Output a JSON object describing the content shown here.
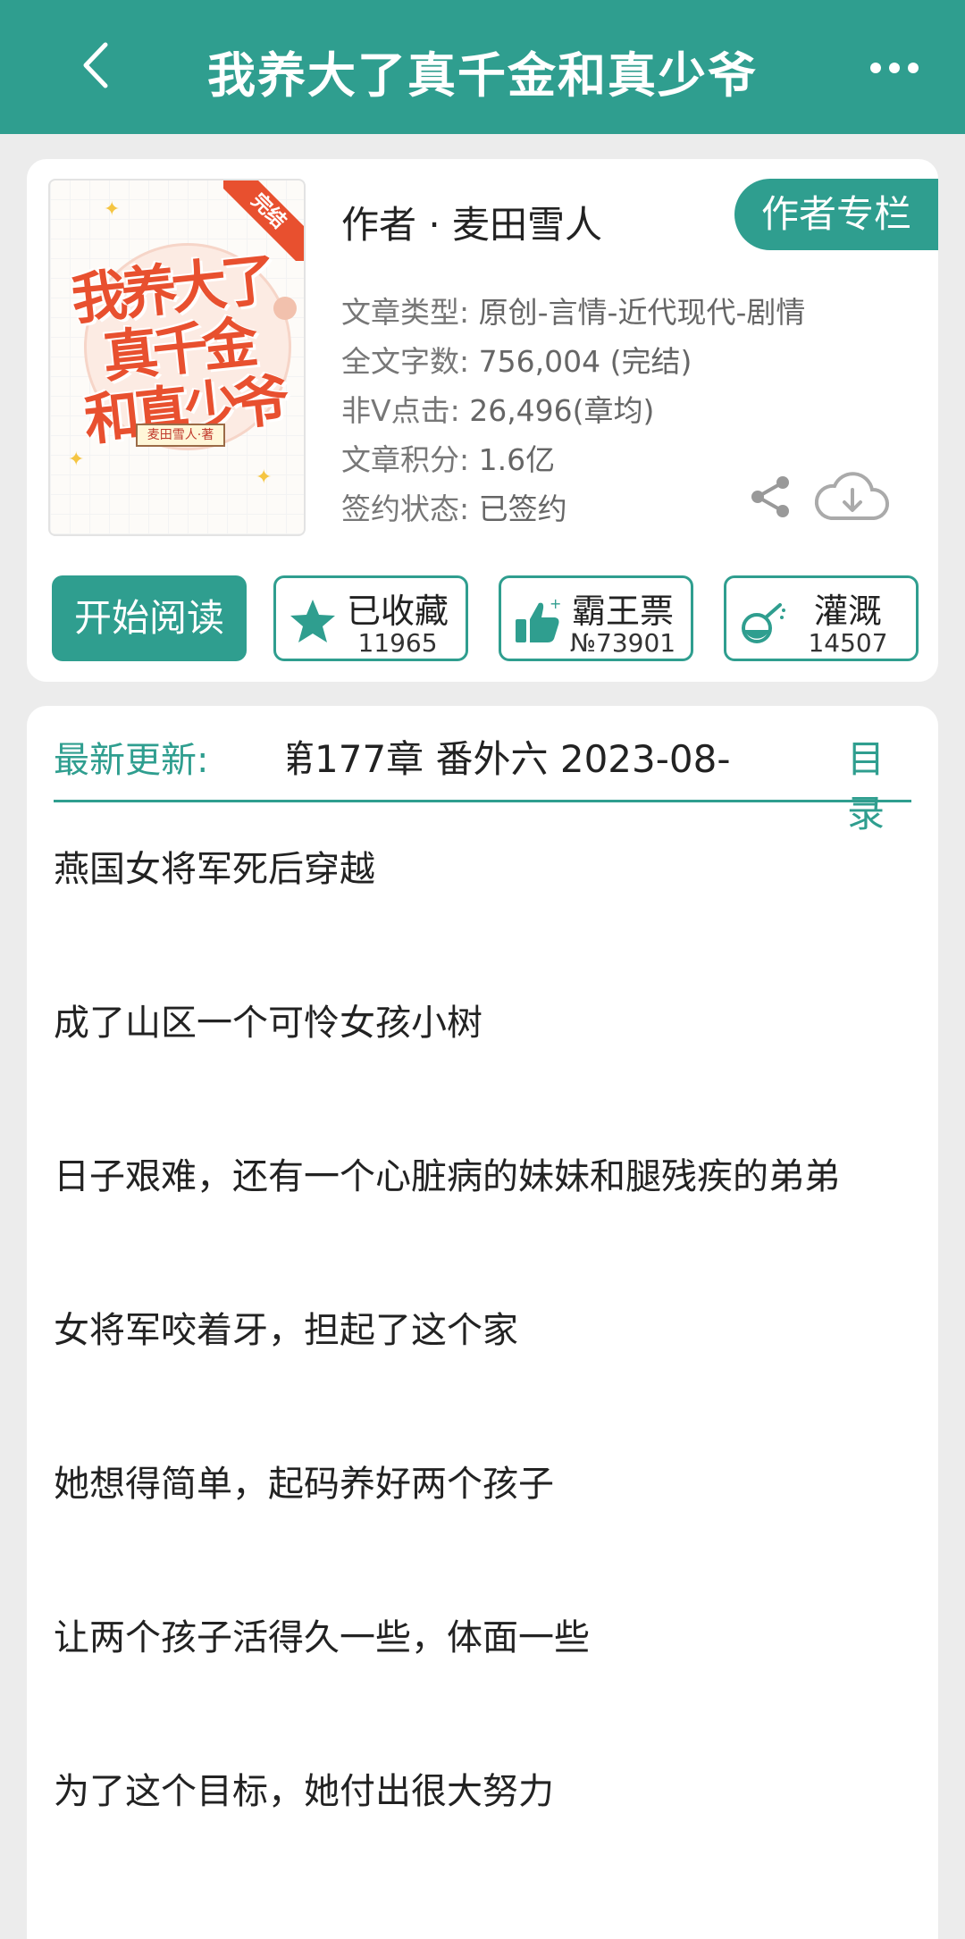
{
  "header": {
    "title": "我养大了真千金和真少爷"
  },
  "book": {
    "cover": {
      "title_line1": "我养大了",
      "title_line2": "真千金",
      "title_line3": "和真少爷",
      "badge": "完结",
      "author_tag": "麦田雪人·著"
    },
    "author_line": "作者 · 麦田雪人",
    "author_column_label": "作者专栏",
    "meta": [
      {
        "key": "文章类型:",
        "value": "原创-言情-近代现代-剧情"
      },
      {
        "key": "全文字数:",
        "value": "756,004 (完结)"
      },
      {
        "key": "非Ⅴ点击:",
        "value": "26,496(章均)"
      },
      {
        "key": "文章积分:",
        "value": "1.6亿"
      },
      {
        "key": "签约状态:",
        "value": "已签约"
      }
    ]
  },
  "actions": {
    "start_reading": "开始阅读",
    "favorite": {
      "label": "已收藏",
      "count": "11965"
    },
    "overlord": {
      "label": "霸王票",
      "count": "№73901"
    },
    "irrigate": {
      "label": "灌溉",
      "count": "14507"
    }
  },
  "update": {
    "label": "最新更新:",
    "text": "第177章  番外六  2023-08-",
    "toc": "目录"
  },
  "description": [
    "燕国女将军死后穿越",
    "成了山区一个可怜女孩小树",
    "日子艰难，还有一个心脏病的妹妹和腿残疾的弟弟",
    "女将军咬着牙，担起了这个家",
    "她想得简单，起码养好两个孩子",
    "让两个孩子活得久一些，体面一些",
    "为了这个目标，她付出很大努力"
  ],
  "colors": {
    "brand": "#2f9e8f",
    "cover_accent": "#e8502f"
  },
  "icons": [
    "back-icon",
    "more-icon",
    "share-icon",
    "download-icon",
    "star-icon",
    "thumbs-up-icon",
    "watering-can-icon"
  ]
}
